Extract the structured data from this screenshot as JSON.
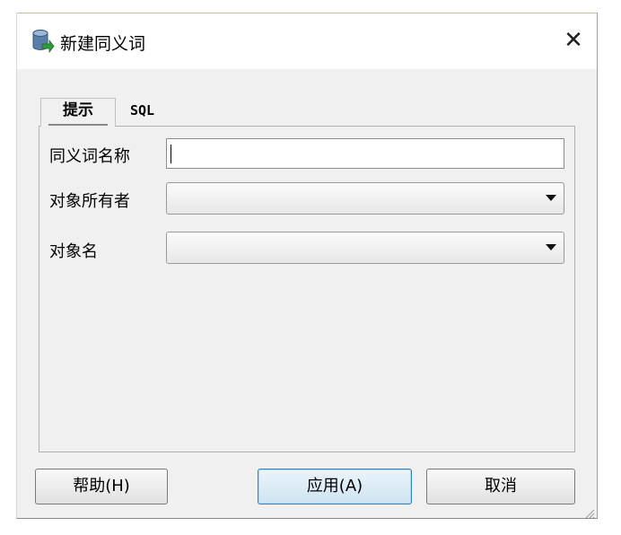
{
  "window": {
    "title": "新建同义词",
    "icon": "database-arrow-icon",
    "close_glyph": "✕"
  },
  "tabs": [
    {
      "label": "提示",
      "active": true
    },
    {
      "label": "SQL",
      "active": false
    }
  ],
  "form": {
    "synonym_name_label": "同义词名称",
    "synonym_name_value": "",
    "object_owner_label": "对象所有者",
    "object_owner_value": "",
    "object_name_label": "对象名",
    "object_name_value": ""
  },
  "buttons": {
    "help": "帮助(H)",
    "apply": "应用(A)",
    "cancel": "取消"
  },
  "colors": {
    "dialog_bg": "#f0f0f0",
    "titlebar_bg": "#ffffff",
    "default_button_border": "#3c7fb1"
  }
}
